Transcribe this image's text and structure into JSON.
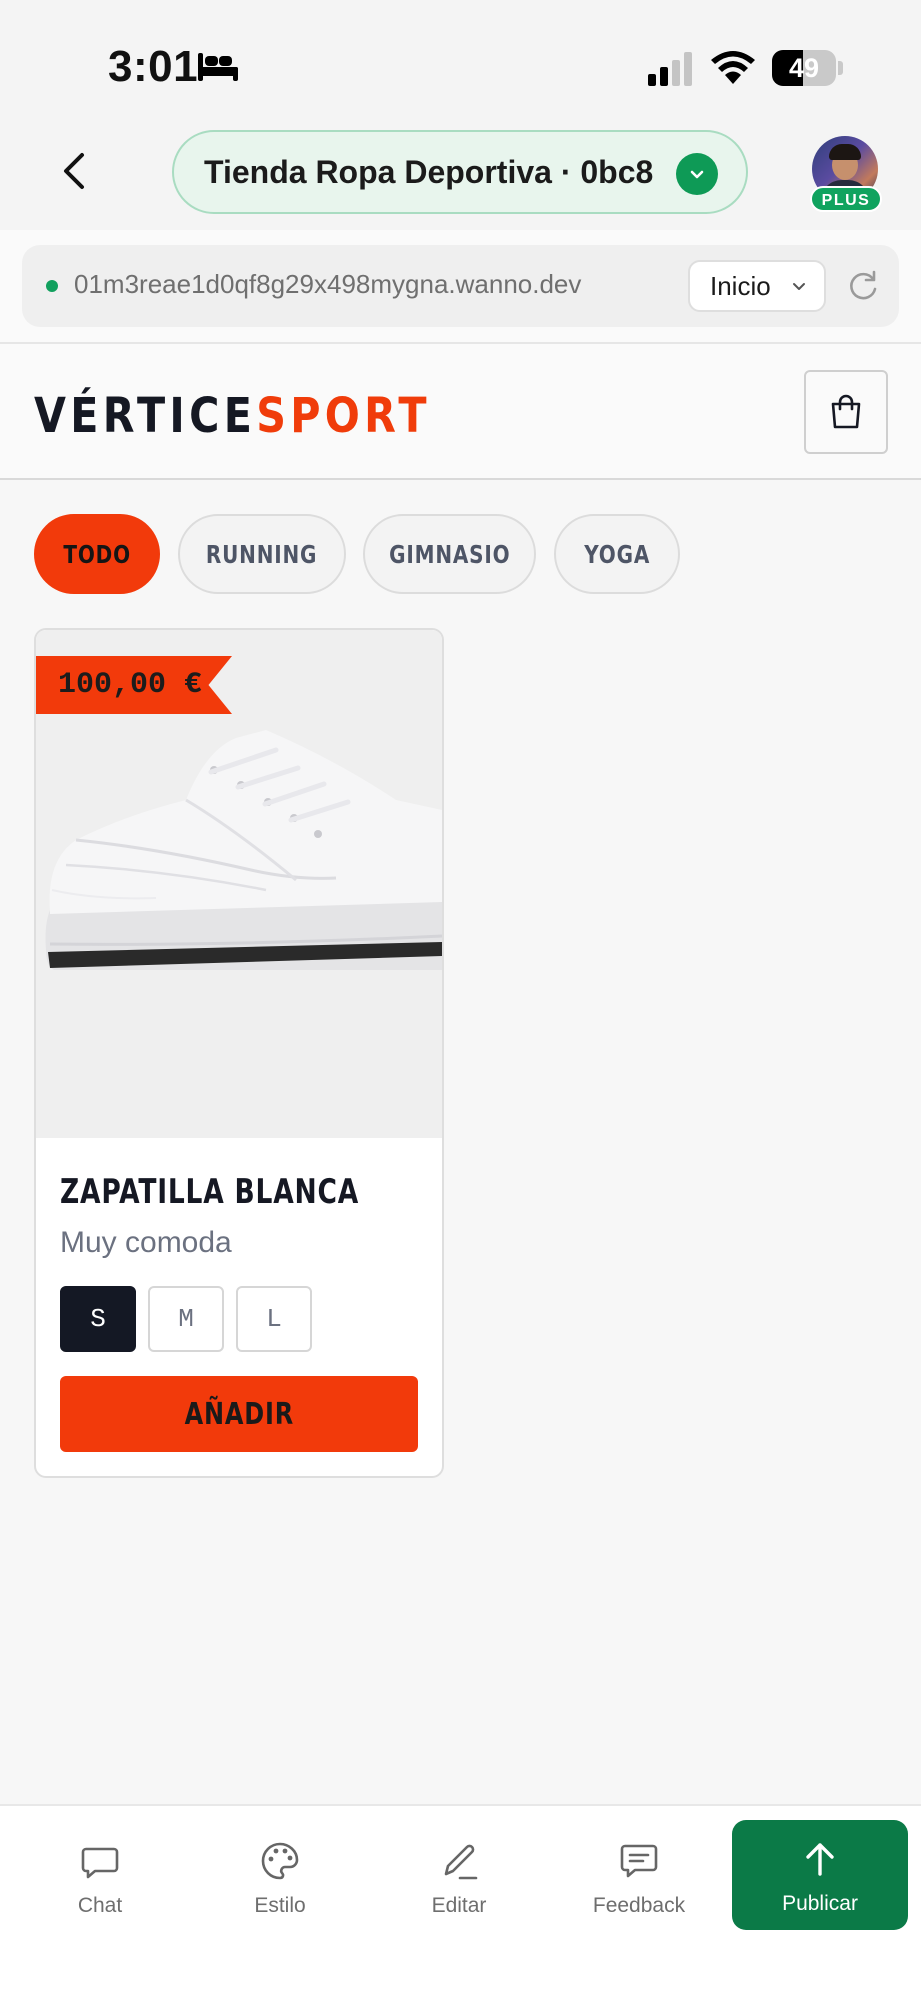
{
  "status_bar": {
    "time": "3:01",
    "battery_level": "49",
    "battery_fraction": 0.49
  },
  "header": {
    "project_name": "Tienda Ropa Deportiva · 0bc8",
    "plan_badge": "PLUS"
  },
  "url_bar": {
    "url": "01m3reae1d0qf8g29x498mygna.wanno.dev",
    "page_select": "Inicio"
  },
  "store": {
    "logo_part1": "VÉRTICE",
    "logo_part2": "SPORT",
    "accent_color": "#f23a0b",
    "categories": [
      {
        "label": "TODO",
        "active": true
      },
      {
        "label": "RUNNING",
        "active": false
      },
      {
        "label": "GIMNASIO",
        "active": false
      },
      {
        "label": "YOGA",
        "active": false
      }
    ]
  },
  "product": {
    "price": "100,00 €",
    "name": "ZAPATILLA BLANCA",
    "description": "Muy comoda",
    "sizes": [
      {
        "label": "S",
        "selected": true
      },
      {
        "label": "M",
        "selected": false
      },
      {
        "label": "L",
        "selected": false
      }
    ],
    "add_label": "AÑADIR"
  },
  "tab_bar": {
    "tabs": [
      {
        "label": "Chat",
        "icon": "chat-icon"
      },
      {
        "label": "Estilo",
        "icon": "palette-icon"
      },
      {
        "label": "Editar",
        "icon": "pencil-icon"
      },
      {
        "label": "Feedback",
        "icon": "feedback-icon"
      }
    ],
    "publish": {
      "label": "Publicar",
      "icon": "arrow-up-icon",
      "color": "#0b7a47"
    }
  }
}
